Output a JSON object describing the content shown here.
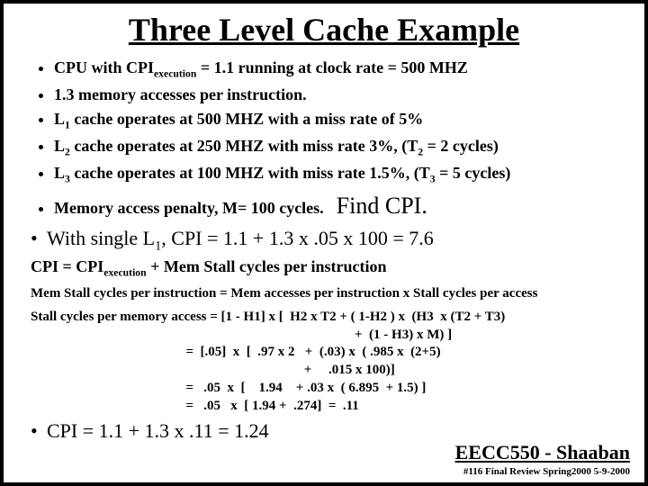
{
  "title": "Three Level Cache Example",
  "bullets": {
    "b1a": "CPU with CPI",
    "b1sub": "execution",
    "b1b": " = 1.1  running at clock rate = 500 MHZ",
    "b2": "1.3 memory accesses per instruction.",
    "b3a": "L",
    "b3sub": "1",
    "b3b": " cache operates at 500 MHZ with a miss rate of 5%",
    "b4a": "L",
    "b4sub": "2",
    "b4b": " cache operates at 250 MHZ with miss rate  3%,   (T",
    "b4sub2": "2",
    "b4c": " = 2 cycles)",
    "b5a": "L",
    "b5sub": "3",
    "b5b": " cache operates at 100 MHZ with miss rate 1.5%,  (T",
    "b5sub2": "3",
    "b5c": " = 5 cycles)",
    "b6": "Memory access penalty,  M= 100 cycles.",
    "findcpi": "Find CPI."
  },
  "bigline1a": "With single L",
  "bigline1sub": "1",
  "bigline1b": ",   CPI = 1.1  +  1.3 x .05 x 100 =  7.6",
  "cpi_eqn_a": "CPI =    CPI",
  "cpi_eqn_sub": "execution",
  "cpi_eqn_b": " +  Mem Stall  cycles per instruction",
  "memstall": "Mem Stall cycles per instruction =  Mem accesses per instruction  x  Stall cycles per access",
  "calc1": "Stall cycles per memory access = [1 - H1] x [  H2 x T2 + ( 1-H2 ) x  (H3  x (T2 + T3)",
  "calc2": "                                                                                                +  (1 - H3) x M) ]",
  "calc3": "                                              =  [.05]  x  [  .97 x 2   +  (.03) x  ( .985 x  (2+5)",
  "calc4": "                                                                                 +     .015 x 100)]",
  "calc5": "                                              =   .05  x  [    1.94    + .03 x  ( 6.895  + 1.5) ]",
  "calc6": "                                              =   .05   x  [ 1.94 +  .274]  =  .11",
  "result": "CPI = 1.1 +  1.3 x .11 = 1.24",
  "footer": {
    "title": "EECC550 - Shaaban",
    "sub": "#116   Final Review   Spring2000   5-9-2000"
  }
}
